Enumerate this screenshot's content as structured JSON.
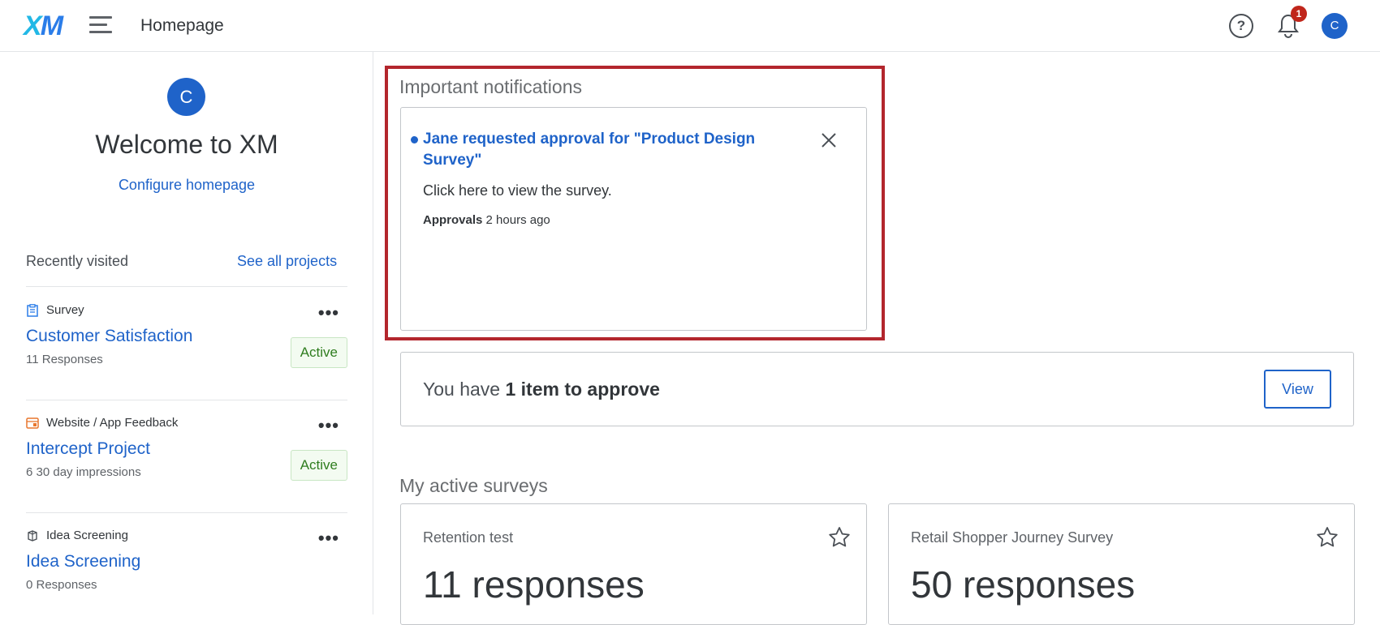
{
  "header": {
    "logo_left": "X",
    "logo_right": "M",
    "title": "Homepage",
    "help_label": "?",
    "notification_count": "1",
    "avatar_initial": "C"
  },
  "sidebar": {
    "avatar_initial": "C",
    "welcome": "Welcome to XM",
    "configure_link": "Configure homepage",
    "recently_visited": "Recently visited",
    "see_all": "See all projects",
    "projects": [
      {
        "type": "Survey",
        "name": "Customer Satisfaction",
        "sub": "11 Responses",
        "status": "Active",
        "more": "•••",
        "icon": "survey-icon"
      },
      {
        "type": "Website / App Feedback",
        "name": "Intercept Project",
        "sub": "6 30 day impressions",
        "status": "Active",
        "more": "•••",
        "icon": "website-feedback-icon"
      },
      {
        "type": "Idea Screening",
        "name": "Idea Screening",
        "sub": "0 Responses",
        "status": "",
        "more": "•••",
        "icon": "idea-screening-icon"
      }
    ]
  },
  "notifications": {
    "title": "Important notifications",
    "items": [
      {
        "headline": "Jane requested approval for \"Product Design Survey\"",
        "body": "Click here to view the survey.",
        "category": "Approvals",
        "time": "2 hours ago"
      }
    ]
  },
  "approvals": {
    "prefix": "You have ",
    "count_text": "1 item to approve",
    "button": "View"
  },
  "surveys": {
    "title": "My active surveys",
    "items": [
      {
        "name": "Retention test",
        "responses": "11 responses"
      },
      {
        "name": "Retail Shopper Journey Survey",
        "responses": "50 responses"
      }
    ]
  },
  "colors": {
    "accent": "#1f63c9",
    "highlight": "#b3262d",
    "badge": "#c0261b",
    "active_text": "#2f7d1f"
  }
}
